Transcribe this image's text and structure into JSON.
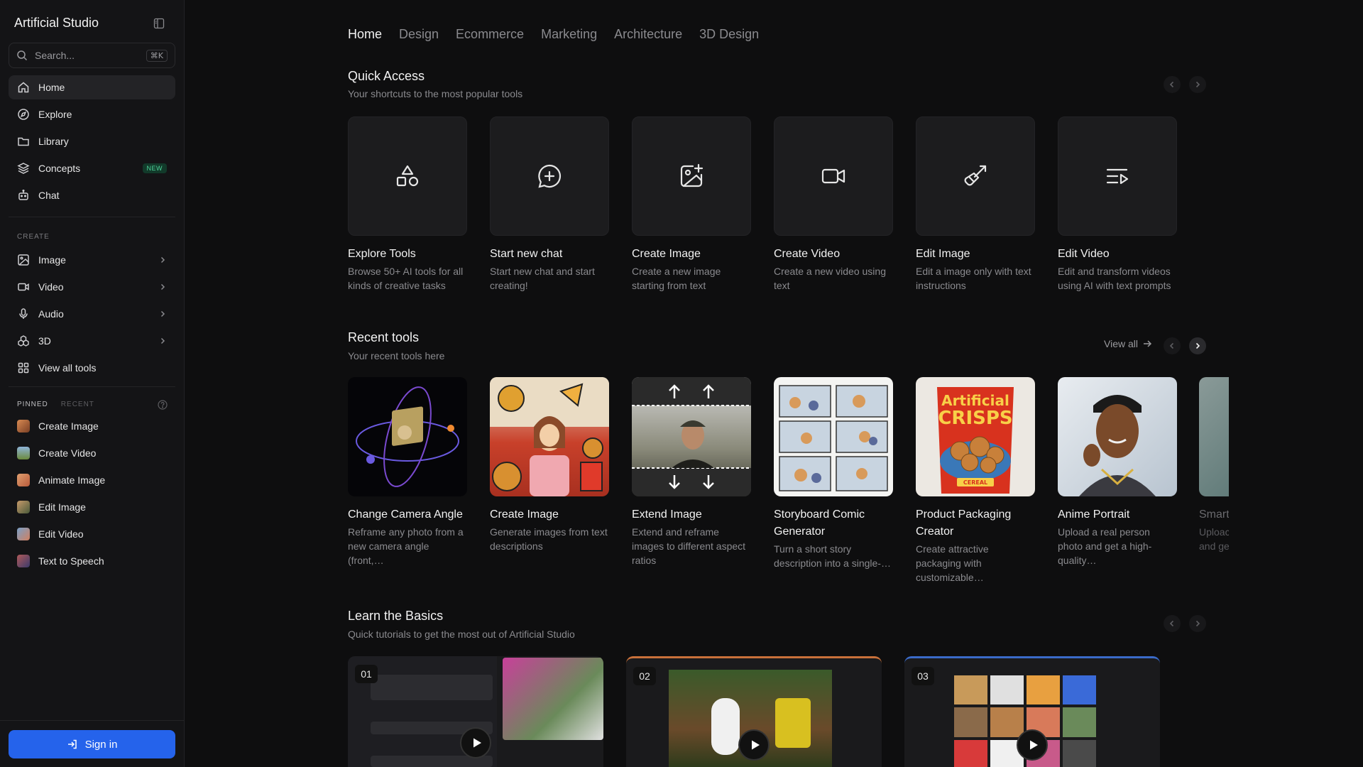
{
  "sidebar": {
    "brand": "Artificial Studio",
    "search": {
      "placeholder": "Search...",
      "shortcut": "⌘K"
    },
    "nav": [
      {
        "label": "Home",
        "icon": "home-icon"
      },
      {
        "label": "Explore",
        "icon": "compass-icon"
      },
      {
        "label": "Library",
        "icon": "folder-icon"
      },
      {
        "label": "Concepts",
        "icon": "layers-icon",
        "badge": "NEW"
      },
      {
        "label": "Chat",
        "icon": "bot-icon"
      }
    ],
    "create_label": "CREATE",
    "create": [
      {
        "label": "Image",
        "icon": "image-icon"
      },
      {
        "label": "Video",
        "icon": "video-icon"
      },
      {
        "label": "Audio",
        "icon": "mic-icon"
      },
      {
        "label": "3D",
        "icon": "cubes-icon"
      },
      {
        "label": "View all tools",
        "icon": "grid-icon"
      }
    ],
    "pinned_label": "PINNED",
    "recent_label": "RECENT",
    "pinned": [
      {
        "label": "Create Image"
      },
      {
        "label": "Create Video"
      },
      {
        "label": "Animate Image"
      },
      {
        "label": "Edit Image"
      },
      {
        "label": "Edit Video"
      },
      {
        "label": "Text to Speech"
      }
    ],
    "signin": "Sign in"
  },
  "topnav": {
    "tabs": [
      "Home",
      "Design",
      "Ecommerce",
      "Marketing",
      "Architecture",
      "3D Design"
    ]
  },
  "quick_access": {
    "title": "Quick Access",
    "subtitle": "Your shortcuts to the most popular tools",
    "items": [
      {
        "title": "Explore Tools",
        "desc": "Browse 50+ AI tools for all kinds of creative tasks",
        "icon": "shapes-icon"
      },
      {
        "title": "Start new chat",
        "desc": "Start new chat and start creating!",
        "icon": "chat-plus-icon"
      },
      {
        "title": "Create Image",
        "desc": "Create a new image starting from text",
        "icon": "image-plus-icon"
      },
      {
        "title": "Create Video",
        "desc": "Create a new video using text",
        "icon": "video-camera-icon"
      },
      {
        "title": "Edit Image",
        "desc": "Edit a image only with text instructions",
        "icon": "paintbrush-icon"
      },
      {
        "title": "Edit Video",
        "desc": "Edit and transform videos using AI with text prompts",
        "icon": "list-video-icon"
      }
    ]
  },
  "recent_tools": {
    "title": "Recent tools",
    "subtitle": "Your recent tools here",
    "view_all": "View all",
    "items": [
      {
        "title": "Change Camera Angle",
        "desc": "Reframe any photo from a new camera angle (front,…"
      },
      {
        "title": "Create Image",
        "desc": "Generate images from text descriptions"
      },
      {
        "title": "Extend Image",
        "desc": "Extend and reframe images to different aspect ratios"
      },
      {
        "title": "Storyboard Comic Generator",
        "desc": "Turn a short story description into a single-…"
      },
      {
        "title": "Product Packaging Creator",
        "desc": "Create attractive packaging with customizable…",
        "art_text": [
          "Artificial",
          "CRISPS",
          "CEREAL"
        ]
      },
      {
        "title": "Anime Portrait",
        "desc": "Upload a real person photo and get a high-quality…"
      }
    ],
    "partial": {
      "title": "Smart",
      "desc_1": "Uploac",
      "desc_2": "and ge"
    }
  },
  "learn": {
    "title": "Learn the Basics",
    "subtitle": "Quick tutorials to get the most out of Artificial Studio",
    "videos": [
      {
        "num": "01"
      },
      {
        "num": "02"
      },
      {
        "num": "03"
      }
    ]
  }
}
